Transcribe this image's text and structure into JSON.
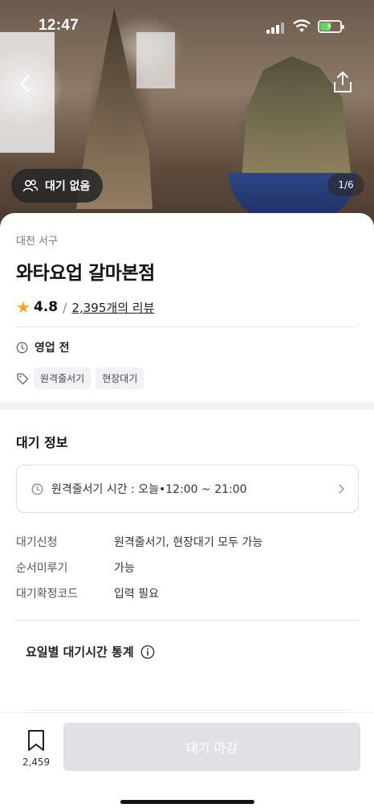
{
  "status_bar": {
    "time": "12:47"
  },
  "hero": {
    "photo_counter": "1/6",
    "wait_status": "대기 없음"
  },
  "store": {
    "region": "대전 서구",
    "name": "와타요업 갈마본점",
    "rating": "4.8",
    "review_link": "2,395개의 리뷰",
    "hours_status": "영업 전",
    "tags": [
      "원격줄서기",
      "현장대기"
    ]
  },
  "wait_info": {
    "title": "대기 정보",
    "remote_time": "원격줄서기 시간 : 오늘•12:00 ~ 21:00",
    "rows": [
      {
        "key": "대기신청",
        "value": "원격줄서기, 현장대기 모두 가능"
      },
      {
        "key": "순서미루기",
        "value": "가능"
      },
      {
        "key": "대기확정코드",
        "value": "입력 필요"
      }
    ]
  },
  "stats": {
    "title": "요일별 대기시간 통계"
  },
  "bottom": {
    "bookmark_count": "2,459",
    "action_label": "대기 마감"
  },
  "colors": {
    "star": "#f5a623",
    "disabled_button": "#dfe1e5",
    "section_gap": "#f2f3f5"
  }
}
